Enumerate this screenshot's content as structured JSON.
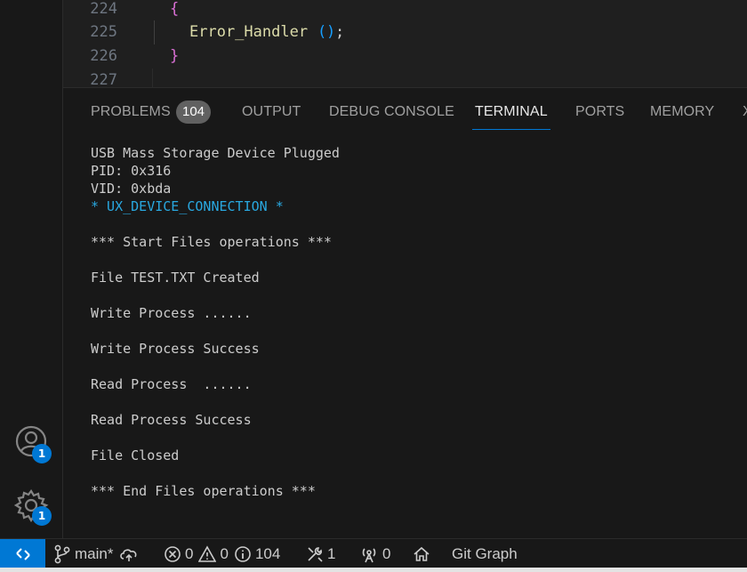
{
  "editor": {
    "lines": [
      {
        "number": "224",
        "code": "{"
      },
      {
        "number": "225",
        "code": "Error_Handler",
        "paren_open": "(",
        "paren_close": ")",
        "semicolon": ";"
      },
      {
        "number": "226",
        "code": "}"
      },
      {
        "number": "227",
        "code": ""
      }
    ]
  },
  "panel": {
    "tabs": [
      {
        "label": "PROBLEMS",
        "badge": "104"
      },
      {
        "label": "OUTPUT"
      },
      {
        "label": "DEBUG CONSOLE"
      },
      {
        "label": "TERMINAL",
        "active": true
      },
      {
        "label": "PORTS"
      },
      {
        "label": "MEMORY"
      },
      {
        "label": "X"
      }
    ]
  },
  "terminal": {
    "lines": [
      "USB Mass Storage Device Plugged",
      "PID: 0x316",
      "VID: 0xbda",
      "* UX_DEVICE_CONNECTION *",
      "",
      "*** Start Files operations ***",
      "",
      "File TEST.TXT Created",
      "",
      "Write Process ......",
      "",
      "Write Process Success",
      "",
      "Read Process  ......",
      "",
      "Read Process Success",
      "",
      "File Closed",
      "",
      "*** End Files operations ***"
    ],
    "highlight_color": "#29a8e0",
    "text_color": "#cccccc"
  },
  "activity_bar": {
    "accounts_badge": "1",
    "settings_badge": "1"
  },
  "status_bar": {
    "branch": "main*",
    "errors": "0",
    "warnings": "0",
    "infos": "104",
    "tools_count": "1",
    "ports_count": "0",
    "git_graph": "Git Graph"
  },
  "colors": {
    "accent": "#0078d4",
    "brace": "#da70d6",
    "function": "#dcdcaa",
    "paren": "#179fff",
    "background": "#181818"
  }
}
